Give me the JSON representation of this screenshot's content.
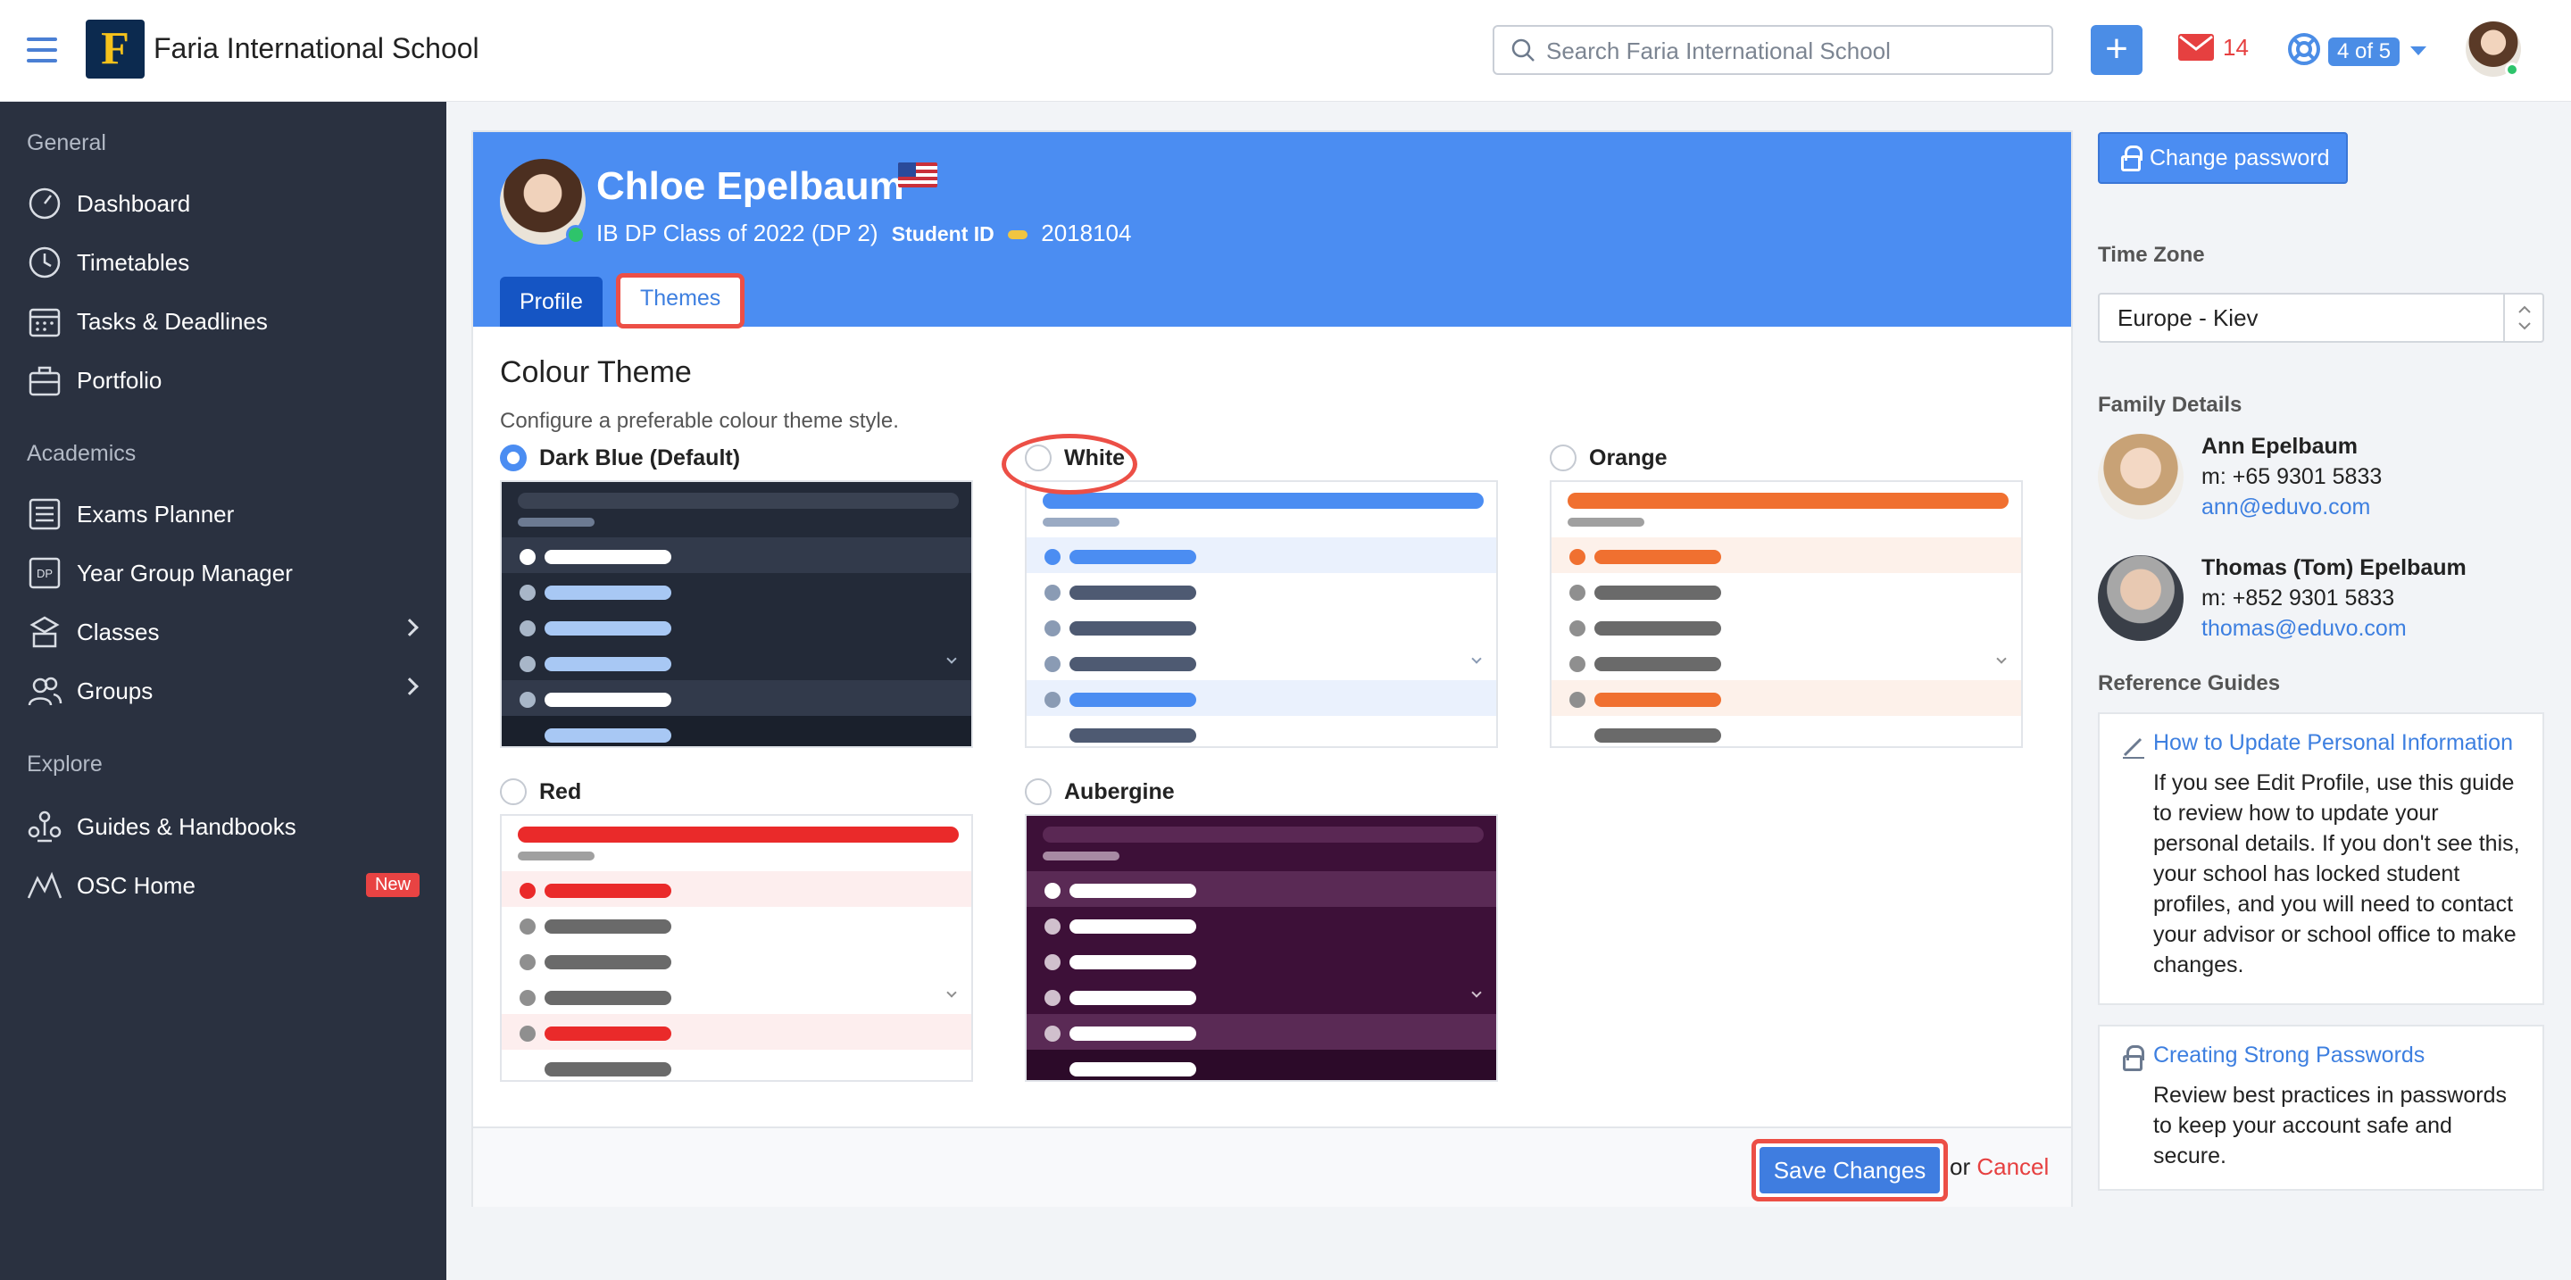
{
  "app": {
    "school_name": "Faria International School"
  },
  "topbar": {
    "search_placeholder": "Search Faria International School",
    "mail_count": "14",
    "support_badge": "4 of 5"
  },
  "sidebar": {
    "sections": [
      {
        "title": "General",
        "items": [
          "Dashboard",
          "Timetables",
          "Tasks & Deadlines",
          "Portfolio"
        ]
      },
      {
        "title": "Academics",
        "items": [
          "Exams Planner",
          "Year Group Manager",
          "Classes",
          "Groups"
        ]
      },
      {
        "title": "Explore",
        "items": [
          "Guides & Handbooks",
          "OSC Home"
        ]
      }
    ],
    "new_badge": "New"
  },
  "profile": {
    "name": "Chloe Epelbaum",
    "class": "IB DP Class of 2022 (DP 2)",
    "student_id_label": "Student ID",
    "student_id": "2018104",
    "tabs": [
      "Profile",
      "Themes"
    ],
    "active_tab": "Themes"
  },
  "themes": {
    "title": "Colour Theme",
    "description": "Configure a preferable colour theme style.",
    "selected": "Dark Blue (Default)",
    "options": [
      {
        "label": "Dark Blue (Default)",
        "bg": "#232a38",
        "top": "#3a4252",
        "sub": "#6c7a92",
        "rowhl": "#323a4b",
        "dot": "#ffffff",
        "bar": "#a8c8f4",
        "hbar": "#ffffff",
        "dotdim": "#a8b6c8",
        "last": "#1a202c"
      },
      {
        "label": "White",
        "bg": "#ffffff",
        "top": "#4b8df2",
        "sub": "#9aaac3",
        "rowhl": "#eaf1fd",
        "dot": "#4b8df2",
        "bar": "#4e5a72",
        "hbar": "#4b8df2",
        "dotdim": "#8a9bb4",
        "last": "#ffffff"
      },
      {
        "label": "Orange",
        "bg": "#ffffff",
        "top": "#f07030",
        "sub": "#a0a0a0",
        "rowhl": "#fdf1ea",
        "dot": "#f07030",
        "bar": "#6a6a6a",
        "hbar": "#f07030",
        "dotdim": "#8f8f8f",
        "last": "#ffffff"
      },
      {
        "label": "Red",
        "bg": "#ffffff",
        "top": "#ea2a2a",
        "sub": "#a0a0a0",
        "rowhl": "#fdeeee",
        "dot": "#ea2a2a",
        "bar": "#6a6a6a",
        "hbar": "#ea2a2a",
        "dotdim": "#8f8f8f",
        "last": "#ffffff"
      },
      {
        "label": "Aubergine",
        "bg": "#3d1038",
        "top": "#5a2854",
        "sub": "#a78aa3",
        "rowhl": "#5a2a55",
        "dot": "#ffffff",
        "bar": "#ffffff",
        "hbar": "#ffffff",
        "dotdim": "#d0c0cd",
        "last": "#2c0a29"
      }
    ]
  },
  "actions": {
    "save": "Save Changes",
    "or": "or",
    "cancel": "Cancel"
  },
  "right": {
    "change_password": "Change password",
    "time_zone_label": "Time Zone",
    "time_zone_value": "Europe - Kiev",
    "family_label": "Family Details",
    "family": [
      {
        "name": "Ann Epelbaum",
        "phone": "m: +65 9301 5833",
        "email": "ann@eduvo.com"
      },
      {
        "name": "Thomas (Tom) Epelbaum",
        "phone": "m: +852 9301 5833",
        "email": "thomas@eduvo.com"
      }
    ],
    "guides_label": "Reference Guides",
    "guides": [
      {
        "title": "How to Update Personal Information",
        "body": "If you see Edit Profile, use this guide to review how to update your personal details. If you don't see this, your school has locked student profiles, and you will need to contact your advisor or school office to make changes."
      },
      {
        "title": "Creating Strong Passwords",
        "body": "Review best practices in passwords to keep your account safe and secure."
      }
    ]
  },
  "colors": {
    "accent": "#4b8df2",
    "sidebar": "#2a3140",
    "highlight": "#ec4f46"
  }
}
